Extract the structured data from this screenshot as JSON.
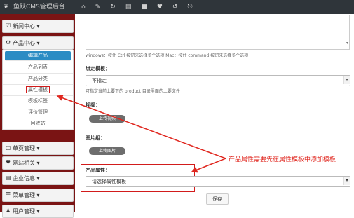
{
  "topbar": {
    "brand": "鱼跃CMS管理后台",
    "icons": [
      "home-icon",
      "edit-icon",
      "refresh-icon",
      "card-icon",
      "lock-icon",
      "heart-icon",
      "reload-icon",
      "logout-icon"
    ],
    "icon_glyphs": [
      "⌂",
      "✎",
      "↻",
      "▤",
      "■",
      "♥",
      "↺",
      "⎋"
    ]
  },
  "sidebar": {
    "groups": [
      {
        "label": "新闻中心",
        "icon": "☑",
        "chevron": "▾"
      },
      {
        "label": "产品中心",
        "icon": "⚙",
        "chevron": "▾"
      },
      {
        "label": "单页管理",
        "icon": "▢",
        "chevron": "▾"
      },
      {
        "label": "网站相关",
        "icon": "♥",
        "chevron": "▾"
      },
      {
        "label": "企业信息",
        "icon": "▤",
        "chevron": "▾"
      },
      {
        "label": "菜单管理",
        "icon": "☰",
        "chevron": "▾"
      },
      {
        "label": "用户管理",
        "icon": "♟",
        "chevron": "▾"
      }
    ],
    "product_items": [
      "编辑产品",
      "产品列表",
      "产品分类",
      "属性模板",
      "模板标签",
      "评价管理",
      "回收站"
    ]
  },
  "form": {
    "multi_select_hint": "windows：按住 Ctrl 按钮来选择多个选项,Mac：按住 command 按钮来选择多个选项",
    "template_label": "绑定模板：",
    "template_value": "不指定",
    "template_hint": "可指定当前上要下的 product 目录里面的上要文件",
    "video_label": "视频：",
    "upload_video": "上传视频",
    "gallery_label": "图片组：",
    "upload_image": "上传图片",
    "attr_label": "产品属性：",
    "attr_placeholder": "请选择属性模板",
    "save": "保存"
  },
  "annotation": {
    "text": "产品属性需要先在属性模板中添加模板",
    "color": "#e0271f"
  }
}
